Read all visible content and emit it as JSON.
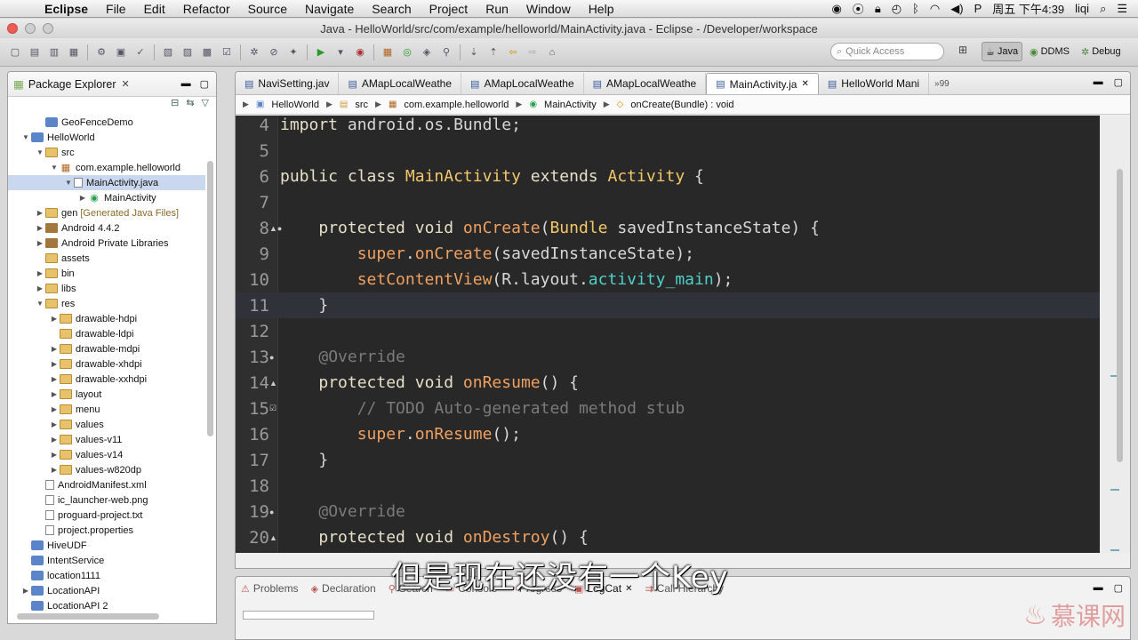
{
  "menubar": {
    "app": "Eclipse",
    "items": [
      "File",
      "Edit",
      "Refactor",
      "Source",
      "Navigate",
      "Search",
      "Project",
      "Run",
      "Window",
      "Help"
    ],
    "clock": "周五 下午4:39",
    "user": "liqi"
  },
  "window": {
    "title": "Java - HelloWorld/src/com/example/helloworld/MainActivity.java - Eclipse - /Developer/workspace"
  },
  "toolbar": {
    "quick_access_placeholder": "Quick Access",
    "perspectives": [
      {
        "label": "Java",
        "active": true
      },
      {
        "label": "DDMS",
        "active": false
      },
      {
        "label": "Debug",
        "active": false
      }
    ]
  },
  "package_explorer": {
    "title": "Package Explorer",
    "tree": [
      {
        "label": "GeoFenceDemo",
        "depth": 1,
        "twisty": "",
        "icon": "proj"
      },
      {
        "label": "HelloWorld",
        "depth": 0,
        "twisty": "▼",
        "icon": "proj"
      },
      {
        "label": "src",
        "depth": 1,
        "twisty": "▼",
        "icon": "folder"
      },
      {
        "label": "com.example.helloworld",
        "depth": 2,
        "twisty": "▼",
        "icon": "pkg"
      },
      {
        "label": "MainActivity.java",
        "depth": 3,
        "twisty": "▼",
        "icon": "file",
        "selected": true
      },
      {
        "label": "MainActivity",
        "depth": 4,
        "twisty": "▶",
        "icon": "cls"
      },
      {
        "label": "gen",
        "note": "[Generated Java Files]",
        "depth": 1,
        "twisty": "▶",
        "icon": "folder"
      },
      {
        "label": "Android 4.4.2",
        "depth": 1,
        "twisty": "▶",
        "icon": "jar"
      },
      {
        "label": "Android Private Libraries",
        "depth": 1,
        "twisty": "▶",
        "icon": "jar"
      },
      {
        "label": "assets",
        "depth": 1,
        "twisty": "",
        "icon": "folder"
      },
      {
        "label": "bin",
        "depth": 1,
        "twisty": "▶",
        "icon": "folder"
      },
      {
        "label": "libs",
        "depth": 1,
        "twisty": "▶",
        "icon": "folder"
      },
      {
        "label": "res",
        "depth": 1,
        "twisty": "▼",
        "icon": "folder"
      },
      {
        "label": "drawable-hdpi",
        "depth": 2,
        "twisty": "▶",
        "icon": "folder"
      },
      {
        "label": "drawable-ldpi",
        "depth": 2,
        "twisty": "",
        "icon": "folder"
      },
      {
        "label": "drawable-mdpi",
        "depth": 2,
        "twisty": "▶",
        "icon": "folder"
      },
      {
        "label": "drawable-xhdpi",
        "depth": 2,
        "twisty": "▶",
        "icon": "folder"
      },
      {
        "label": "drawable-xxhdpi",
        "depth": 2,
        "twisty": "▶",
        "icon": "folder"
      },
      {
        "label": "layout",
        "depth": 2,
        "twisty": "▶",
        "icon": "folder"
      },
      {
        "label": "menu",
        "depth": 2,
        "twisty": "▶",
        "icon": "folder"
      },
      {
        "label": "values",
        "depth": 2,
        "twisty": "▶",
        "icon": "folder"
      },
      {
        "label": "values-v11",
        "depth": 2,
        "twisty": "▶",
        "icon": "folder"
      },
      {
        "label": "values-v14",
        "depth": 2,
        "twisty": "▶",
        "icon": "folder"
      },
      {
        "label": "values-w820dp",
        "depth": 2,
        "twisty": "▶",
        "icon": "folder"
      },
      {
        "label": "AndroidManifest.xml",
        "depth": 1,
        "twisty": "",
        "icon": "file"
      },
      {
        "label": "ic_launcher-web.png",
        "depth": 1,
        "twisty": "",
        "icon": "file"
      },
      {
        "label": "proguard-project.txt",
        "depth": 1,
        "twisty": "",
        "icon": "file"
      },
      {
        "label": "project.properties",
        "depth": 1,
        "twisty": "",
        "icon": "file"
      },
      {
        "label": "HiveUDF",
        "depth": 0,
        "twisty": "",
        "icon": "proj"
      },
      {
        "label": "IntentService",
        "depth": 0,
        "twisty": "",
        "icon": "proj"
      },
      {
        "label": "location1111",
        "depth": 0,
        "twisty": "",
        "icon": "proj"
      },
      {
        "label": "LocationAPI",
        "depth": 0,
        "twisty": "▶",
        "icon": "proj"
      },
      {
        "label": "LocationAPI 2",
        "depth": 0,
        "twisty": "",
        "icon": "proj"
      }
    ]
  },
  "editor": {
    "tabs": [
      {
        "label": "NaviSetting.jav",
        "active": false
      },
      {
        "label": "AMapLocalWeathe",
        "active": false
      },
      {
        "label": "AMapLocalWeathe",
        "active": false
      },
      {
        "label": "AMapLocalWeathe",
        "active": false
      },
      {
        "label": "MainActivity.ja",
        "active": true
      },
      {
        "label": "HelloWorld Mani",
        "active": false
      }
    ],
    "tab_overflow": "»99",
    "breadcrumb": [
      "HelloWorld",
      "src",
      "com.example.helloworld",
      "MainActivity",
      "onCreate(Bundle) : void"
    ],
    "lines": [
      {
        "n": "4",
        "mark": ""
      },
      {
        "n": "5",
        "mark": ""
      },
      {
        "n": "6",
        "mark": ""
      },
      {
        "n": "7",
        "mark": ""
      },
      {
        "n": "8",
        "mark": "▲●"
      },
      {
        "n": "9",
        "mark": ""
      },
      {
        "n": "10",
        "mark": ""
      },
      {
        "n": "11",
        "mark": ""
      },
      {
        "n": "12",
        "mark": ""
      },
      {
        "n": "13",
        "mark": "●"
      },
      {
        "n": "14",
        "mark": "▲"
      },
      {
        "n": "15",
        "mark": "☑"
      },
      {
        "n": "16",
        "mark": ""
      },
      {
        "n": "17",
        "mark": ""
      },
      {
        "n": "18",
        "mark": ""
      },
      {
        "n": "19",
        "mark": "●"
      },
      {
        "n": "20",
        "mark": "▲"
      }
    ],
    "code": {
      "l4_kw": "import",
      "l4_rest": " android.os.Bundle;",
      "l6_kw": "public class ",
      "l6_name": "MainActivity",
      "l6_ext": " extends ",
      "l6_type": "Activity",
      "l6_brace": " {",
      "l8_kw": "protected void ",
      "l8_m": "onCreate",
      "l8_p1": "(",
      "l8_type": "Bundle",
      "l8_arg": " savedInstanceState) {",
      "l9_kw": "super",
      "l9_dot": ".",
      "l9_m": "onCreate",
      "l9_arg": "(savedInstanceState);",
      "l10_m": "setContentView",
      "l10_p": "(R.layout.",
      "l10_f": "activity_main",
      "l10_end": ");",
      "l11": "}",
      "l13": "@Override",
      "l14_kw": "protected void ",
      "l14_m": "onResume",
      "l14_end": "() {",
      "l15": "// TODO Auto-generated method stub",
      "l16_kw": "super",
      "l16_dot": ".",
      "l16_m": "onResume",
      "l16_end": "();",
      "l17": "}",
      "l19": "@Override",
      "l20_kw": "protected void ",
      "l20_m": "onDestroy",
      "l20_end": "() {"
    }
  },
  "bottom": {
    "tabs": [
      {
        "label": "Problems",
        "active": false
      },
      {
        "label": "Declaration",
        "active": false
      },
      {
        "label": "Search",
        "active": false
      },
      {
        "label": "Console",
        "active": false
      },
      {
        "label": "Progress",
        "active": false
      },
      {
        "label": "LogCat",
        "active": true
      },
      {
        "label": "Call Hierarchy",
        "active": false
      }
    ]
  },
  "overlay": {
    "subtitle": "但是现在还没有一个Key",
    "watermark": "慕课网"
  }
}
